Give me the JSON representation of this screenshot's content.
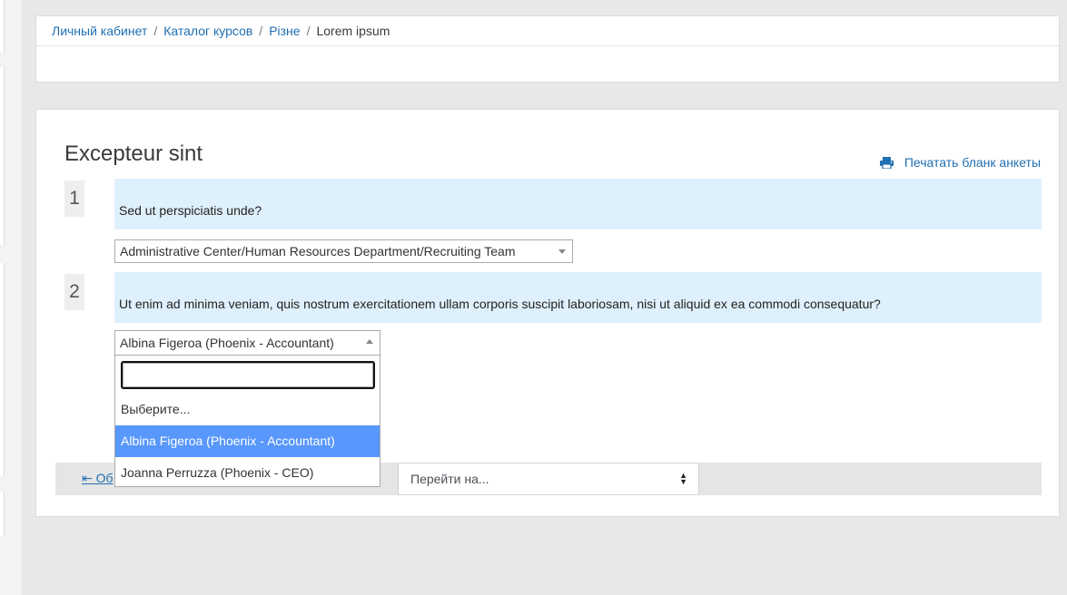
{
  "breadcrumb": {
    "items": [
      "Личный кабинет",
      "Каталог курсов",
      "Різне"
    ],
    "current": "Lorem ipsum",
    "separator": "/"
  },
  "page": {
    "title": "Excepteur sint",
    "print_label": "Печатать бланк анкеты"
  },
  "questions": [
    {
      "number": "1",
      "text": "Sed ut perspiciatis unde?",
      "selected": "Administrative Center/Human Resources Department/Recruiting Team"
    },
    {
      "number": "2",
      "text": "Ut enim ad minima veniam, quis nostrum exercitationem ullam corporis suscipit laboriosam, nisi ut aliquid ex ea commodi consequatur?",
      "selected": "Albina Figeroa (Phoenix - Accountant)"
    }
  ],
  "dropdown": {
    "search_value": "",
    "options": [
      "Выберите...",
      "Albina Figeroa (Phoenix - Accountant)",
      "Joanna Perruzza (Phoenix - CEO)"
    ],
    "highlighted_index": 1
  },
  "nav": {
    "back_label": "Об",
    "jump_label": "Перейти на..."
  },
  "colors": {
    "link": "#1f6fb2",
    "question_bg": "#def0fb",
    "highlight": "#5897fb"
  }
}
